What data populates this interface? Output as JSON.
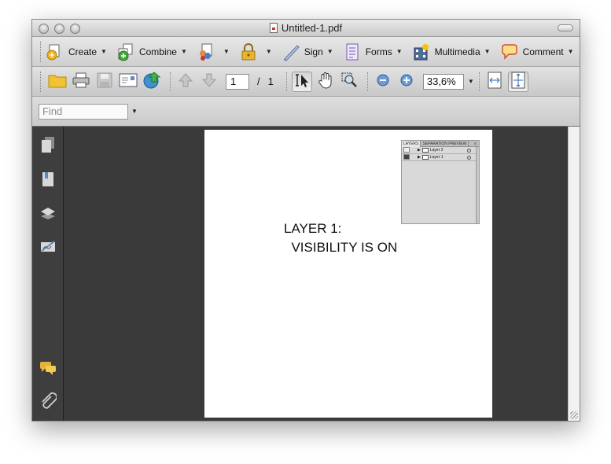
{
  "window": {
    "title": "Untitled-1.pdf"
  },
  "toolbar": {
    "create": "Create",
    "combine": "Combine",
    "sign": "Sign",
    "forms": "Forms",
    "multimedia": "Multimedia",
    "comment": "Comment"
  },
  "nav": {
    "page_current": "1",
    "page_sep": "/",
    "page_total": "1",
    "zoom": "33,6%"
  },
  "find": {
    "placeholder": "Find"
  },
  "document": {
    "text": "LAYER 1:\n  VISIBILITY IS ON"
  },
  "layers_panel": {
    "tabs": [
      "LAYERS",
      "SEPARATION PREVIEW"
    ],
    "rows": [
      {
        "name": "Layer 2",
        "visible": false
      },
      {
        "name": "Layer 1",
        "visible": true
      }
    ]
  },
  "colors": {
    "doc_bg": "#3a3a3a",
    "sidebar_bg": "#3e3e3e"
  }
}
